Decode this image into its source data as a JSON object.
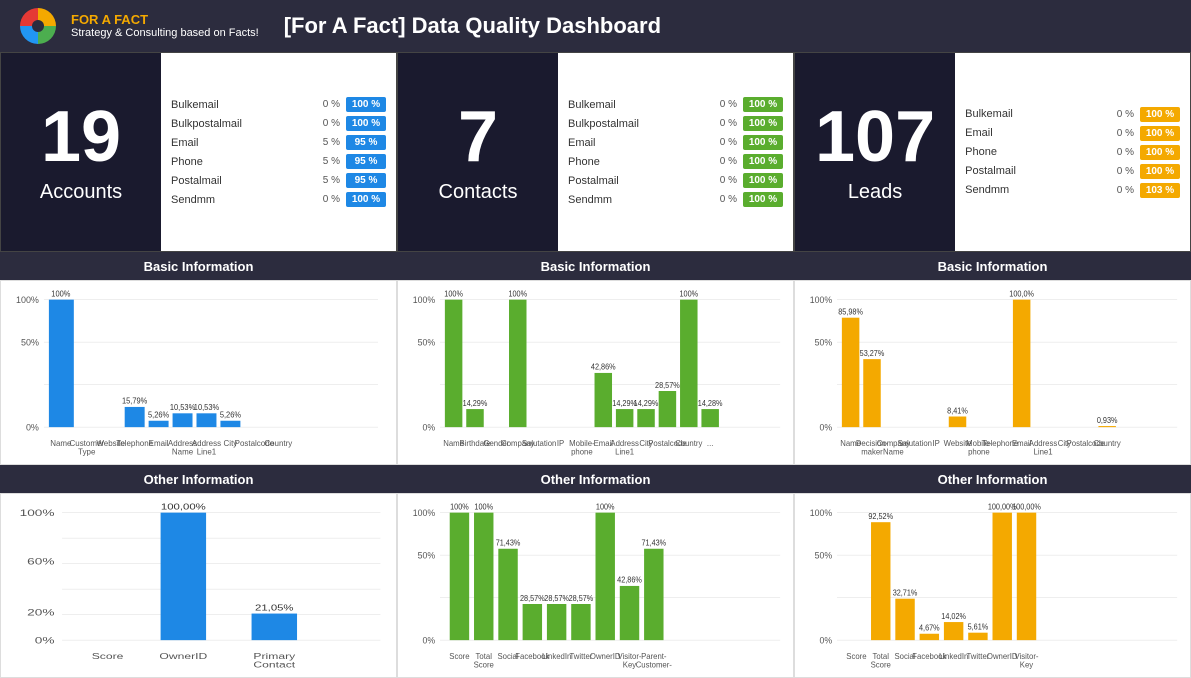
{
  "header": {
    "title": "[For A Fact] Data Quality Dashboard",
    "logo_brand": "FOR A FACT",
    "logo_tagline": "Strategy & Consulting based on Facts!"
  },
  "panels": {
    "accounts": {
      "number": "19",
      "label": "Accounts",
      "color": "blue",
      "rows": [
        {
          "name": "Bulkemail",
          "pct": "0 %",
          "badge": "100 %"
        },
        {
          "name": "Bulkpostalmail",
          "pct": "0 %",
          "badge": "100 %"
        },
        {
          "name": "Email",
          "pct": "5 %",
          "badge": "95 %"
        },
        {
          "name": "Phone",
          "pct": "5 %",
          "badge": "95 %"
        },
        {
          "name": "Postalmail",
          "pct": "5 %",
          "badge": "95 %"
        },
        {
          "name": "Sendmm",
          "pct": "0 %",
          "badge": "100 %"
        }
      ]
    },
    "contacts": {
      "number": "7",
      "label": "Contacts",
      "color": "green",
      "rows": [
        {
          "name": "Bulkemail",
          "pct": "0 %",
          "badge": "100 %"
        },
        {
          "name": "Bulkpostalmail",
          "pct": "0 %",
          "badge": "100 %"
        },
        {
          "name": "Email",
          "pct": "0 %",
          "badge": "100 %"
        },
        {
          "name": "Phone",
          "pct": "0 %",
          "badge": "100 %"
        },
        {
          "name": "Postalmail",
          "pct": "0 %",
          "badge": "100 %"
        },
        {
          "name": "Sendmm",
          "pct": "0 %",
          "badge": "100 %"
        }
      ]
    },
    "leads": {
      "number": "107",
      "label": "Leads",
      "color": "orange",
      "rows": [
        {
          "name": "Bulkemail",
          "pct": "0 %",
          "badge": "100 %"
        },
        {
          "name": "Email",
          "pct": "0 %",
          "badge": "100 %"
        },
        {
          "name": "Phone",
          "pct": "0 %",
          "badge": "100 %"
        },
        {
          "name": "Postalmail",
          "pct": "0 %",
          "badge": "100 %"
        },
        {
          "name": "Sendmm",
          "pct": "0 %",
          "badge": "103 %"
        }
      ]
    }
  },
  "sections": {
    "basic_info_label": "Basic Information",
    "other_info_label": "Other Information"
  }
}
